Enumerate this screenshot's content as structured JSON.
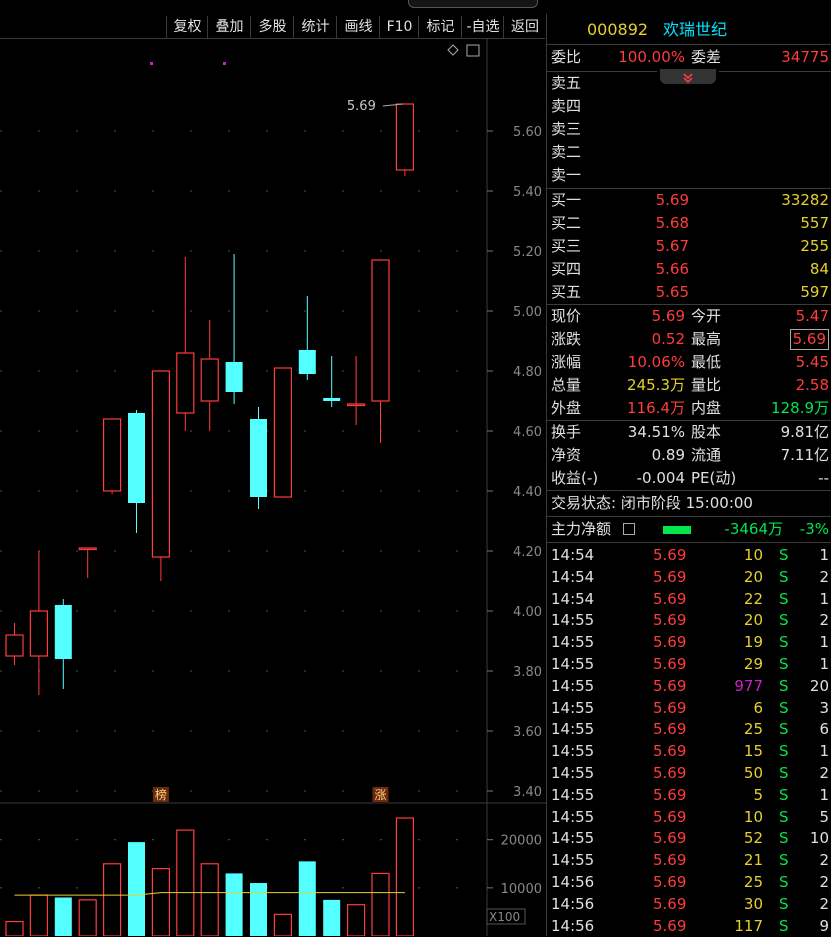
{
  "toolbar": {
    "buttons": [
      "复权",
      "叠加",
      "多股",
      "统计",
      "画线",
      "F10",
      "标记",
      "-自选",
      "返回"
    ]
  },
  "chart_data": {
    "type": "candlestick",
    "price_axis": {
      "ticks": [
        5.6,
        5.4,
        5.2,
        5.0,
        4.8,
        4.6,
        4.4,
        4.2,
        4.0,
        3.8,
        3.6,
        3.4
      ],
      "ylim": [
        3.33,
        5.77
      ]
    },
    "volume_axis": {
      "ticks": [
        20000,
        10000
      ],
      "unit": "X100",
      "ylim": [
        0,
        27000
      ]
    },
    "high_label": "5.69",
    "markers": [
      {
        "text": "榜",
        "candle": 6
      },
      {
        "text": "涨",
        "candle": 15
      }
    ],
    "candles": [
      {
        "o": 3.85,
        "h": 3.96,
        "l": 3.82,
        "c": 3.92,
        "v": 3000
      },
      {
        "o": 3.85,
        "h": 4.2,
        "l": 3.72,
        "c": 4.0,
        "v": 8500
      },
      {
        "o": 4.02,
        "h": 4.04,
        "l": 3.74,
        "c": 3.84,
        "v": 8000
      },
      {
        "o": 4.21,
        "h": 4.21,
        "l": 4.11,
        "c": 4.21,
        "v": 7500
      },
      {
        "o": 4.4,
        "h": 4.63,
        "l": 4.39,
        "c": 4.64,
        "v": 15000
      },
      {
        "o": 4.66,
        "h": 4.67,
        "l": 4.26,
        "c": 4.36,
        "v": 19500
      },
      {
        "o": 4.18,
        "h": 4.8,
        "l": 4.1,
        "c": 4.8,
        "v": 14000
      },
      {
        "o": 4.66,
        "h": 5.18,
        "l": 4.6,
        "c": 4.86,
        "v": 22000
      },
      {
        "o": 4.7,
        "h": 4.97,
        "l": 4.6,
        "c": 4.84,
        "v": 15000
      },
      {
        "o": 4.83,
        "h": 5.19,
        "l": 4.69,
        "c": 4.73,
        "v": 13000
      },
      {
        "o": 4.64,
        "h": 4.68,
        "l": 4.34,
        "c": 4.38,
        "v": 11000
      },
      {
        "o": 4.38,
        "h": 4.81,
        "l": 4.38,
        "c": 4.81,
        "v": 4500
      },
      {
        "o": 4.87,
        "h": 5.05,
        "l": 4.77,
        "c": 4.79,
        "v": 15500
      },
      {
        "o": 4.71,
        "h": 4.85,
        "l": 4.68,
        "c": 4.7,
        "v": 7500
      },
      {
        "o": 4.69,
        "h": 4.85,
        "l": 4.62,
        "c": 4.69,
        "v": 6500
      },
      {
        "o": 4.7,
        "h": 5.17,
        "l": 4.56,
        "c": 5.17,
        "v": 13000
      },
      {
        "o": 5.47,
        "h": 5.69,
        "l": 5.45,
        "c": 5.69,
        "v": 24500
      }
    ]
  },
  "quote": {
    "code": "000892",
    "name": "欢瑞世纪",
    "webi_label": "委比",
    "webi_value": "100.00%",
    "weicha_label": "委差",
    "weicha_value": "34775",
    "sell_labels": [
      "卖五",
      "卖四",
      "卖三",
      "卖二",
      "卖一"
    ],
    "buy": [
      {
        "label": "买一",
        "price": "5.69",
        "vol": "33282"
      },
      {
        "label": "买二",
        "price": "5.68",
        "vol": "557"
      },
      {
        "label": "买三",
        "price": "5.67",
        "vol": "255"
      },
      {
        "label": "买四",
        "price": "5.66",
        "vol": "84"
      },
      {
        "label": "买五",
        "price": "5.65",
        "vol": "597"
      }
    ],
    "stats1": [
      {
        "l1": "现价",
        "v1": "5.69",
        "l2": "今开",
        "v2": "5.47"
      },
      {
        "l1": "涨跌",
        "v1": "0.52",
        "l2": "最高",
        "v2": "5.69"
      },
      {
        "l1": "涨幅",
        "v1": "10.06%",
        "l2": "最低",
        "v2": "5.45"
      },
      {
        "l1": "总量",
        "v1": "245.3万",
        "l2": "量比",
        "v2": "2.58"
      },
      {
        "l1": "外盘",
        "v1": "116.4万",
        "l2": "内盘",
        "v2": "128.9万"
      }
    ],
    "stats2": [
      {
        "l1": "换手",
        "v1": "34.51%",
        "l2": "股本",
        "v2": "9.81亿"
      },
      {
        "l1": "净资",
        "v1": "0.89",
        "l2": "流通",
        "v2": "7.11亿"
      },
      {
        "l1": "收益(-)",
        "v1": "-0.004",
        "l2": "PE(动)",
        "v2": "--"
      }
    ],
    "trade_state": "交易状态: 闭市阶段 15:00:00",
    "main_flow_label": "主力净额",
    "main_flow_value": "-3464万",
    "main_flow_pct": "-3%",
    "ticks": [
      {
        "t": "14:54",
        "p": "5.69",
        "v": "10",
        "s": "S",
        "n": "1"
      },
      {
        "t": "14:54",
        "p": "5.69",
        "v": "20",
        "s": "S",
        "n": "2"
      },
      {
        "t": "14:54",
        "p": "5.69",
        "v": "22",
        "s": "S",
        "n": "1"
      },
      {
        "t": "14:55",
        "p": "5.69",
        "v": "20",
        "s": "S",
        "n": "2"
      },
      {
        "t": "14:55",
        "p": "5.69",
        "v": "19",
        "s": "S",
        "n": "1"
      },
      {
        "t": "14:55",
        "p": "5.69",
        "v": "29",
        "s": "S",
        "n": "1"
      },
      {
        "t": "14:55",
        "p": "5.69",
        "v": "977",
        "s": "S",
        "n": "20"
      },
      {
        "t": "14:55",
        "p": "5.69",
        "v": "6",
        "s": "S",
        "n": "3"
      },
      {
        "t": "14:55",
        "p": "5.69",
        "v": "25",
        "s": "S",
        "n": "6"
      },
      {
        "t": "14:55",
        "p": "5.69",
        "v": "15",
        "s": "S",
        "n": "1"
      },
      {
        "t": "14:55",
        "p": "5.69",
        "v": "50",
        "s": "S",
        "n": "2"
      },
      {
        "t": "14:55",
        "p": "5.69",
        "v": "5",
        "s": "S",
        "n": "1"
      },
      {
        "t": "14:55",
        "p": "5.69",
        "v": "10",
        "s": "S",
        "n": "5"
      },
      {
        "t": "14:55",
        "p": "5.69",
        "v": "52",
        "s": "S",
        "n": "10"
      },
      {
        "t": "14:55",
        "p": "5.69",
        "v": "21",
        "s": "S",
        "n": "2"
      },
      {
        "t": "14:56",
        "p": "5.69",
        "v": "25",
        "s": "S",
        "n": "2"
      },
      {
        "t": "14:56",
        "p": "5.69",
        "v": "30",
        "s": "S",
        "n": "2"
      },
      {
        "t": "14:56",
        "p": "5.69",
        "v": "117",
        "s": "S",
        "n": "9"
      }
    ]
  }
}
